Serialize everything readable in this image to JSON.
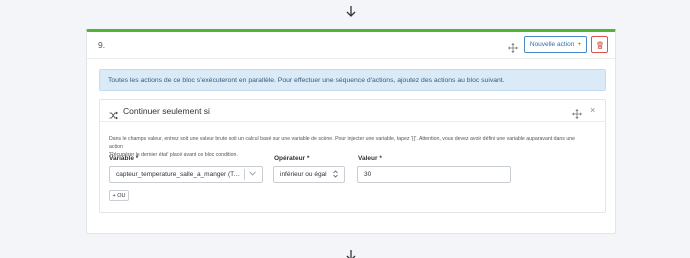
{
  "block": {
    "title": "9.",
    "new_action_label": "Nouvelle action",
    "new_action_plus": "+",
    "info": "Toutes les actions de ce bloc s'exécuteront en parallèle. Pour effectuer une séquence d'actions, ajoutez des actions au bloc suivant."
  },
  "condition": {
    "title": "Continuer seulement si",
    "close": "×",
    "help_line1": "Dans le champs valeur, entrez soit une valeur brute soit un calcul basé sur une variable de scène. Pour injecter une variable, tapez '{{'. Attention, vous devez avoir défini une variable auparavant dans une action",
    "help_line2": "'Récupérer le dernier état' placé avant ce bloc condition.",
    "labels": {
      "variable": "Variable *",
      "operator": "Opérateur *",
      "value": "Valeur *"
    },
    "variable_value": "capteur_temperature_salle_a_manger (Tem...",
    "operator_value": "inférieur ou égal",
    "value_value": "30",
    "or_button": "+ OU"
  },
  "colors": {
    "accent_green": "#54b335",
    "primary_blue": "#4a87c6",
    "danger_red": "#d9534f",
    "info_bg": "#dbeaf7"
  }
}
